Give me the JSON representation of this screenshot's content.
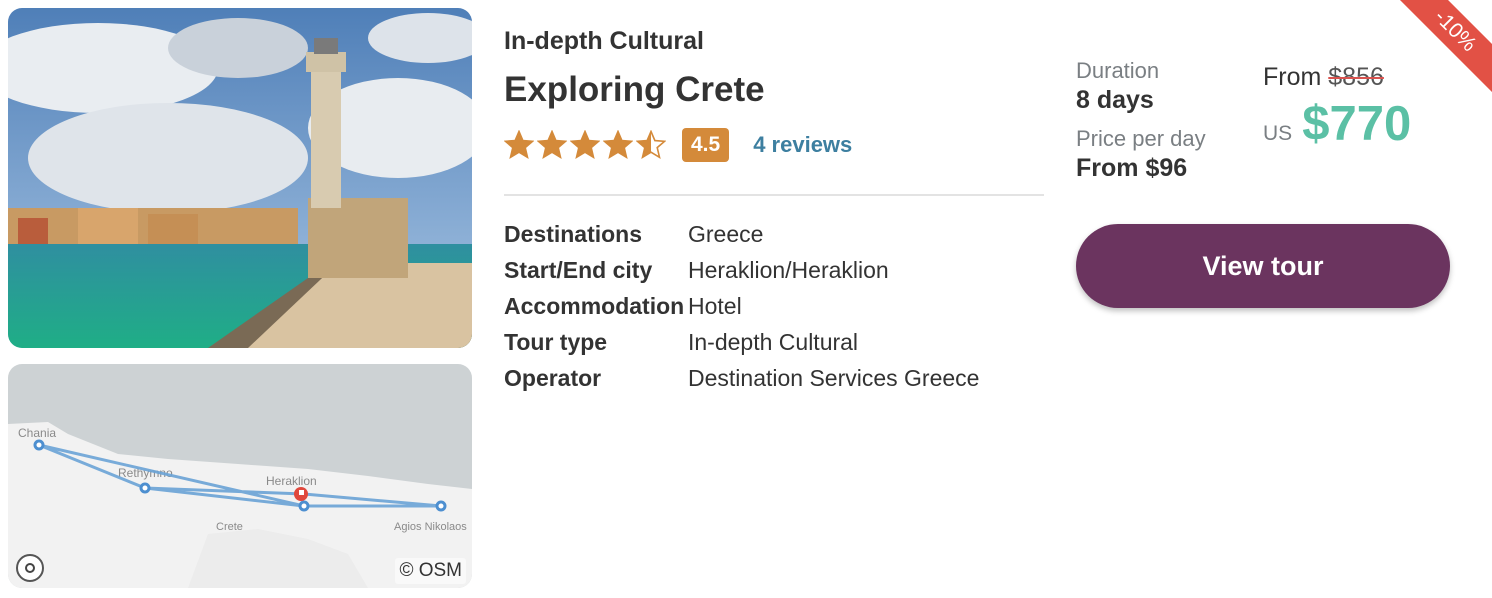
{
  "tour": {
    "subtitle": "In-depth Cultural",
    "title": "Exploring Crete",
    "rating": 4.5,
    "rating_label": "4.5",
    "reviews_label": "4 reviews"
  },
  "details": [
    {
      "label": "Destinations",
      "value": "Greece"
    },
    {
      "label": "Start/End city",
      "value": "Heraklion/Heraklion"
    },
    {
      "label": "Accommodation",
      "value": "Hotel"
    },
    {
      "label": "Tour type",
      "value": "In-depth Cultural"
    },
    {
      "label": "Operator",
      "value": "Destination Services Greece"
    }
  ],
  "meta": {
    "duration_label": "Duration",
    "duration_value": "8 days",
    "per_day_label": "Price per day",
    "per_day_value": "From $96"
  },
  "pricing": {
    "from_label": "From",
    "old_price": "$856",
    "currency": "US",
    "price": "$770",
    "discount": "-10%"
  },
  "cta": {
    "label": "View tour"
  },
  "map": {
    "attribution": "© OSM",
    "labels": [
      "Chania",
      "Rethymno",
      "Heraklion",
      "Crete",
      "Agios Nikolaos"
    ]
  },
  "colors": {
    "accent_button": "#6b345f",
    "price_green": "#5bc0a5",
    "rating_orange": "#d48a3a",
    "link_blue": "#3d7fa0",
    "discount_red": "#e25145"
  },
  "icons": {
    "star": "star-icon",
    "half_star": "star-half-icon",
    "map_control": "map-control-icon",
    "start_marker": "flag-marker-icon"
  }
}
